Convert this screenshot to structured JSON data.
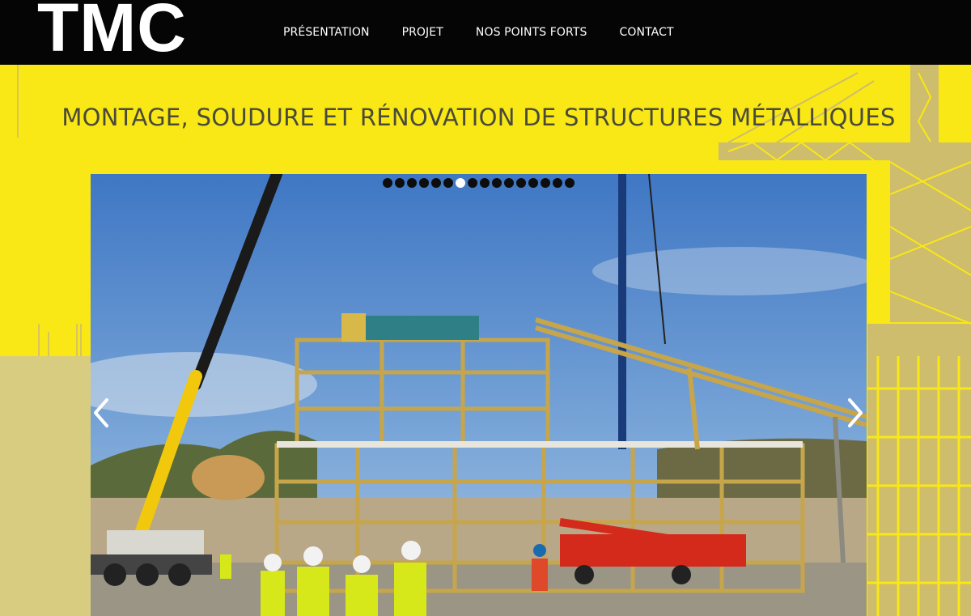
{
  "brand": {
    "logo_text": "TMC"
  },
  "nav": {
    "items": [
      "PRÉSENTATION",
      "PROJET",
      "NOS POINTS FORTS",
      "CONTACT"
    ]
  },
  "main": {
    "title": "MONTAGE, SOUDURE ET RÉNOVATION DE STRUCTURES MÉTALLIQUES"
  },
  "slider": {
    "slide_count": 16,
    "active_index": 6,
    "prev_icon": "chevron-left-icon",
    "next_icon": "chevron-right-icon"
  },
  "colors": {
    "header_bg": "#050505",
    "page_bg": "#f9e816",
    "title_text": "#4a4a3a",
    "crane_deco": "#cdbd6c",
    "sky": "#4a7fc6"
  }
}
